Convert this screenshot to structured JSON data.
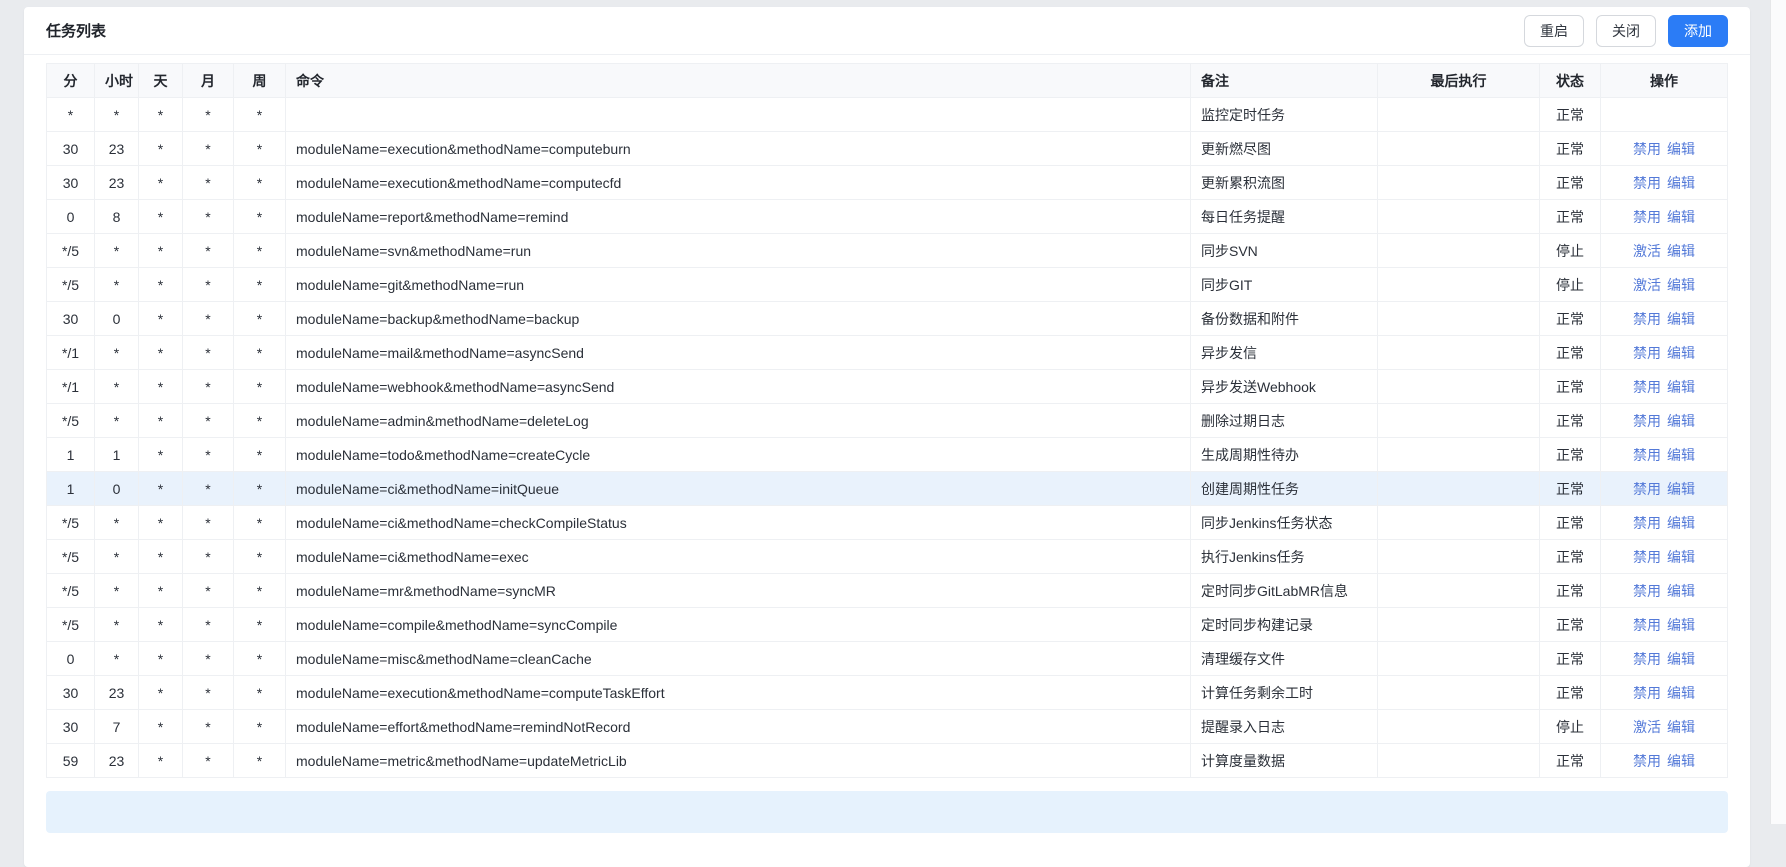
{
  "header": {
    "title": "任务列表",
    "buttons": {
      "restart": "重启",
      "close": "关闭",
      "add": "添加"
    }
  },
  "table": {
    "columns": [
      {
        "key": "minute",
        "label": "分"
      },
      {
        "key": "hour",
        "label": "小时"
      },
      {
        "key": "day",
        "label": "天"
      },
      {
        "key": "month",
        "label": "月"
      },
      {
        "key": "week",
        "label": "周"
      },
      {
        "key": "command",
        "label": "命令"
      },
      {
        "key": "remark",
        "label": "备注"
      },
      {
        "key": "lastExec",
        "label": "最后执行"
      },
      {
        "key": "status",
        "label": "状态"
      },
      {
        "key": "actions",
        "label": "操作"
      }
    ],
    "rows": [
      {
        "minute": "*",
        "hour": "*",
        "day": "*",
        "month": "*",
        "week": "*",
        "command": "",
        "remark": "监控定时任务",
        "lastExec": "",
        "status": "正常",
        "actions": []
      },
      {
        "minute": "30",
        "hour": "23",
        "day": "*",
        "month": "*",
        "week": "*",
        "command": "moduleName=execution&methodName=computeburn",
        "remark": "更新燃尽图",
        "lastExec": "",
        "status": "正常",
        "actions": [
          {
            "name": "disable",
            "label": "禁用"
          },
          {
            "name": "edit",
            "label": "编辑"
          }
        ]
      },
      {
        "minute": "30",
        "hour": "23",
        "day": "*",
        "month": "*",
        "week": "*",
        "command": "moduleName=execution&methodName=computecfd",
        "remark": "更新累积流图",
        "lastExec": "",
        "status": "正常",
        "actions": [
          {
            "name": "disable",
            "label": "禁用"
          },
          {
            "name": "edit",
            "label": "编辑"
          }
        ]
      },
      {
        "minute": "0",
        "hour": "8",
        "day": "*",
        "month": "*",
        "week": "*",
        "command": "moduleName=report&methodName=remind",
        "remark": "每日任务提醒",
        "lastExec": "",
        "status": "正常",
        "actions": [
          {
            "name": "disable",
            "label": "禁用"
          },
          {
            "name": "edit",
            "label": "编辑"
          }
        ]
      },
      {
        "minute": "*/5",
        "hour": "*",
        "day": "*",
        "month": "*",
        "week": "*",
        "command": "moduleName=svn&methodName=run",
        "remark": "同步SVN",
        "lastExec": "",
        "status": "停止",
        "actions": [
          {
            "name": "activate",
            "label": "激活"
          },
          {
            "name": "edit",
            "label": "编辑"
          }
        ]
      },
      {
        "minute": "*/5",
        "hour": "*",
        "day": "*",
        "month": "*",
        "week": "*",
        "command": "moduleName=git&methodName=run",
        "remark": "同步GIT",
        "lastExec": "",
        "status": "停止",
        "actions": [
          {
            "name": "activate",
            "label": "激活"
          },
          {
            "name": "edit",
            "label": "编辑"
          }
        ]
      },
      {
        "minute": "30",
        "hour": "0",
        "day": "*",
        "month": "*",
        "week": "*",
        "command": "moduleName=backup&methodName=backup",
        "remark": "备份数据和附件",
        "lastExec": "",
        "status": "正常",
        "actions": [
          {
            "name": "disable",
            "label": "禁用"
          },
          {
            "name": "edit",
            "label": "编辑"
          }
        ]
      },
      {
        "minute": "*/1",
        "hour": "*",
        "day": "*",
        "month": "*",
        "week": "*",
        "command": "moduleName=mail&methodName=asyncSend",
        "remark": "异步发信",
        "lastExec": "",
        "status": "正常",
        "actions": [
          {
            "name": "disable",
            "label": "禁用"
          },
          {
            "name": "edit",
            "label": "编辑"
          }
        ]
      },
      {
        "minute": "*/1",
        "hour": "*",
        "day": "*",
        "month": "*",
        "week": "*",
        "command": "moduleName=webhook&methodName=asyncSend",
        "remark": "异步发送Webhook",
        "lastExec": "",
        "status": "正常",
        "actions": [
          {
            "name": "disable",
            "label": "禁用"
          },
          {
            "name": "edit",
            "label": "编辑"
          }
        ]
      },
      {
        "minute": "*/5",
        "hour": "*",
        "day": "*",
        "month": "*",
        "week": "*",
        "command": "moduleName=admin&methodName=deleteLog",
        "remark": "删除过期日志",
        "lastExec": "",
        "status": "正常",
        "actions": [
          {
            "name": "disable",
            "label": "禁用"
          },
          {
            "name": "edit",
            "label": "编辑"
          }
        ]
      },
      {
        "minute": "1",
        "hour": "1",
        "day": "*",
        "month": "*",
        "week": "*",
        "command": "moduleName=todo&methodName=createCycle",
        "remark": "生成周期性待办",
        "lastExec": "",
        "status": "正常",
        "actions": [
          {
            "name": "disable",
            "label": "禁用"
          },
          {
            "name": "edit",
            "label": "编辑"
          }
        ]
      },
      {
        "minute": "1",
        "hour": "0",
        "day": "*",
        "month": "*",
        "week": "*",
        "command": "moduleName=ci&methodName=initQueue",
        "remark": "创建周期性任务",
        "lastExec": "",
        "status": "正常",
        "highlighted": true,
        "actions": [
          {
            "name": "disable",
            "label": "禁用"
          },
          {
            "name": "edit",
            "label": "编辑"
          }
        ]
      },
      {
        "minute": "*/5",
        "hour": "*",
        "day": "*",
        "month": "*",
        "week": "*",
        "command": "moduleName=ci&methodName=checkCompileStatus",
        "remark": "同步Jenkins任务状态",
        "lastExec": "",
        "status": "正常",
        "actions": [
          {
            "name": "disable",
            "label": "禁用"
          },
          {
            "name": "edit",
            "label": "编辑"
          }
        ]
      },
      {
        "minute": "*/5",
        "hour": "*",
        "day": "*",
        "month": "*",
        "week": "*",
        "command": "moduleName=ci&methodName=exec",
        "remark": "执行Jenkins任务",
        "lastExec": "",
        "status": "正常",
        "actions": [
          {
            "name": "disable",
            "label": "禁用"
          },
          {
            "name": "edit",
            "label": "编辑"
          }
        ]
      },
      {
        "minute": "*/5",
        "hour": "*",
        "day": "*",
        "month": "*",
        "week": "*",
        "command": "moduleName=mr&methodName=syncMR",
        "remark": "定时同步GitLabMR信息",
        "lastExec": "",
        "status": "正常",
        "actions": [
          {
            "name": "disable",
            "label": "禁用"
          },
          {
            "name": "edit",
            "label": "编辑"
          }
        ]
      },
      {
        "minute": "*/5",
        "hour": "*",
        "day": "*",
        "month": "*",
        "week": "*",
        "command": "moduleName=compile&methodName=syncCompile",
        "remark": "定时同步构建记录",
        "lastExec": "",
        "status": "正常",
        "actions": [
          {
            "name": "disable",
            "label": "禁用"
          },
          {
            "name": "edit",
            "label": "编辑"
          }
        ]
      },
      {
        "minute": "0",
        "hour": "*",
        "day": "*",
        "month": "*",
        "week": "*",
        "command": "moduleName=misc&methodName=cleanCache",
        "remark": "清理缓存文件",
        "lastExec": "",
        "status": "正常",
        "actions": [
          {
            "name": "disable",
            "label": "禁用"
          },
          {
            "name": "edit",
            "label": "编辑"
          }
        ]
      },
      {
        "minute": "30",
        "hour": "23",
        "day": "*",
        "month": "*",
        "week": "*",
        "command": "moduleName=execution&methodName=computeTaskEffort",
        "remark": "计算任务剩余工时",
        "lastExec": "",
        "status": "正常",
        "actions": [
          {
            "name": "disable",
            "label": "禁用"
          },
          {
            "name": "edit",
            "label": "编辑"
          }
        ]
      },
      {
        "minute": "30",
        "hour": "7",
        "day": "*",
        "month": "*",
        "week": "*",
        "command": "moduleName=effort&methodName=remindNotRecord",
        "remark": "提醒录入日志",
        "lastExec": "",
        "status": "停止",
        "actions": [
          {
            "name": "activate",
            "label": "激活"
          },
          {
            "name": "edit",
            "label": "编辑"
          }
        ]
      },
      {
        "minute": "59",
        "hour": "23",
        "day": "*",
        "month": "*",
        "week": "*",
        "command": "moduleName=metric&methodName=updateMetricLib",
        "remark": "计算度量数据",
        "lastExec": "",
        "status": "正常",
        "actions": [
          {
            "name": "disable",
            "label": "禁用"
          },
          {
            "name": "edit",
            "label": "编辑"
          }
        ]
      }
    ]
  },
  "colors": {
    "primary": "#2b7cf6",
    "link": "#5379d8",
    "highlight_row": "#e9f2fc",
    "footer_bar": "#e6f2fd",
    "page_background": "#e9ebee"
  }
}
